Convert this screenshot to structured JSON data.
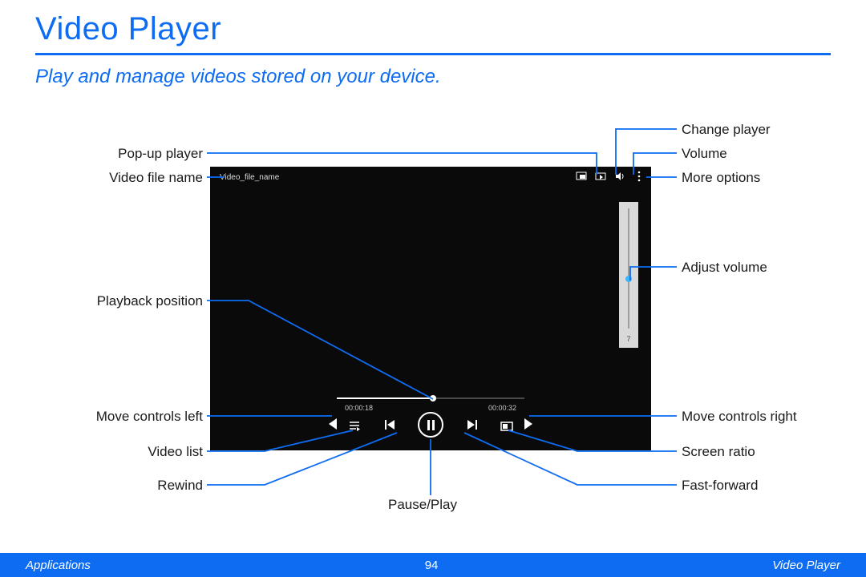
{
  "heading": "Video Player",
  "subtitle": "Play and manage videos stored on your device.",
  "player": {
    "file_name": "Video_file_name",
    "volume_value": "7",
    "time_elapsed": "00:00:18",
    "time_total": "00:00:32"
  },
  "labels": {
    "popup_player": "Pop-up player",
    "video_file_name": "Video file name",
    "playback_position": "Playback position",
    "move_controls_left": "Move controls left",
    "video_list": "Video list",
    "rewind": "Rewind",
    "pause_play": "Pause/Play",
    "change_player": "Change player",
    "volume": "Volume",
    "more_options": "More options",
    "adjust_volume": "Adjust volume",
    "move_controls_right": "Move controls right",
    "screen_ratio": "Screen ratio",
    "fast_forward": "Fast-forward"
  },
  "footer": {
    "left": "Applications",
    "page": "94",
    "right": "Video Player"
  }
}
